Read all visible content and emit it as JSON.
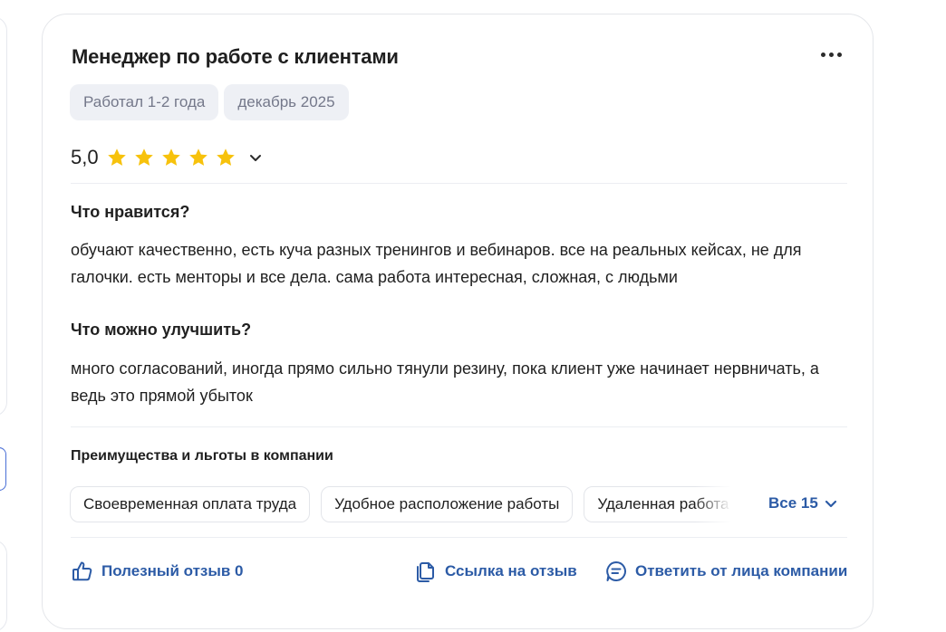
{
  "review": {
    "title": "Менеджер по работе с клиентами",
    "tags": [
      "Работал 1-2 года",
      "декабрь 2025"
    ],
    "rating": {
      "value": "5,0",
      "stars": 5,
      "max_stars": 5
    },
    "pros": {
      "heading": "Что нравится?",
      "text": "обучают качественно, есть куча разных тренингов и вебинаров. все на реальных кейсах, не для галочки. есть менторы и все дела. сама работа интересная, сложная, с людьми"
    },
    "cons": {
      "heading": "Что можно улучшить?",
      "text": "много согласований, иногда прямо сильно тянули резину, пока клиент уже начинает нервничать, а ведь это прямой убыток"
    },
    "benefits": {
      "heading": "Преимущества и льготы в компании",
      "items": [
        "Своевременная оплата труда",
        "Удобное расположение работы",
        "Удаленная работа"
      ],
      "all_label": "Все 15"
    },
    "actions": {
      "helpful": "Полезный отзыв 0",
      "link": "Ссылка на отзыв",
      "reply": "Ответить от лица компании"
    }
  },
  "colors": {
    "accent": "#2c5ba6",
    "star": "#f7c20c",
    "chip_bg": "#eef0f5",
    "chip_text": "#74788a"
  },
  "icons": [
    "more-dots-icon",
    "star-icon",
    "chevron-down-icon",
    "thumb-up-icon",
    "copy-link-icon",
    "chat-reply-icon"
  ]
}
